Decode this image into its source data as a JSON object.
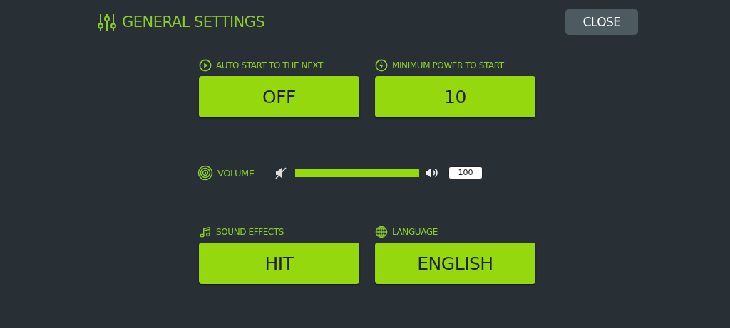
{
  "header": {
    "title": "GENERAL SETTINGS",
    "close_button": "CLOSE"
  },
  "top_settings": [
    {
      "kind": "play",
      "label": "AUTO START TO THE NEXT",
      "value": "OFF"
    },
    {
      "kind": "power",
      "label": "MINIMUM POWER TO START",
      "value": "10"
    }
  ],
  "volume": {
    "label": "VOLUME",
    "level": 1,
    "reading": "100"
  },
  "bottom_settings": [
    {
      "kind": "music",
      "label": "SOUND EFFECTS",
      "value": "HIT"
    },
    {
      "kind": "globe",
      "label": "LANGUAGE",
      "value": "ENGLISH"
    }
  ]
}
